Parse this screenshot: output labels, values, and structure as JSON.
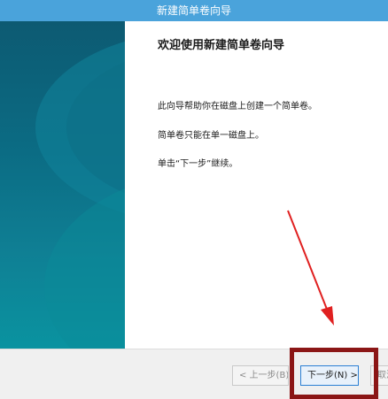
{
  "window": {
    "title": "新建简单卷向导"
  },
  "content": {
    "heading": "欢迎使用新建简单卷向导",
    "paragraphs": [
      "此向导帮助你在磁盘上创建一个简单卷。",
      "简单卷只能在单一磁盘上。",
      "单击“下一步”继续。"
    ]
  },
  "buttons": {
    "back": "< 上一步(B)",
    "next": "下一步(N) >",
    "cancel": "取消"
  },
  "colors": {
    "titlebar": "#4aa3db",
    "banner": "#0b6c84",
    "highlight": "#8b1616",
    "arrow": "#e02020"
  },
  "icons": {
    "annotation_arrow": "red-arrow-icon"
  }
}
